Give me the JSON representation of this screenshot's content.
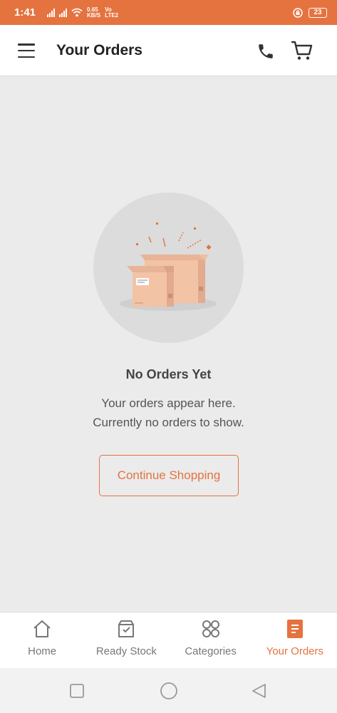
{
  "status_bar": {
    "time": "1:41",
    "speed_value": "0.65",
    "speed_unit": "KB/S",
    "network_top": "Vo",
    "network_bottom": "LTE2",
    "battery": "23"
  },
  "header": {
    "title": "Your Orders",
    "menu_icon": "hamburger-menu-icon",
    "phone_icon": "phone-icon",
    "cart_icon": "cart-icon"
  },
  "empty_state": {
    "illustration": "open-boxes-illustration",
    "title": "No Orders Yet",
    "message_line1": "Your orders appear here.",
    "message_line2": "Currently no orders to show.",
    "button_label": "Continue Shopping"
  },
  "bottom_nav": {
    "items": [
      {
        "label": "Home",
        "icon": "home-icon",
        "active": false
      },
      {
        "label": "Ready Stock",
        "icon": "ready-stock-icon",
        "active": false
      },
      {
        "label": "Categories",
        "icon": "categories-icon",
        "active": false
      },
      {
        "label": "Your Orders",
        "icon": "orders-icon",
        "active": true
      }
    ]
  },
  "colors": {
    "accent": "#e5733f",
    "background": "#ebebeb",
    "text_dark": "#222222",
    "text_muted": "#777777"
  }
}
